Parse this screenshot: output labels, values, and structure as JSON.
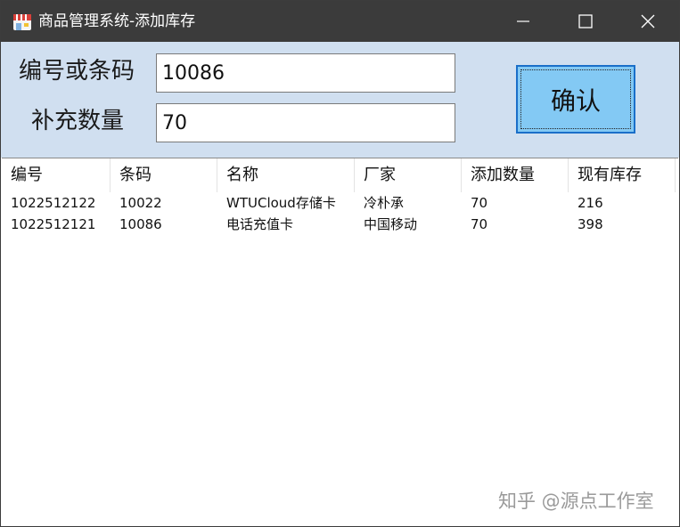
{
  "window": {
    "title": "商品管理系统-添加库存",
    "icon": "store-icon",
    "controls": [
      "minimize-icon",
      "maximize-icon",
      "close-icon"
    ],
    "titlebar_color": "#3b3b3b"
  },
  "form": {
    "code_label": "编号或条码",
    "code_value": "10086",
    "qty_label": "补充数量",
    "qty_value": "70",
    "confirm_label": "确认",
    "panel_color": "#d0dff0",
    "button_color": "#83c9f4"
  },
  "table": {
    "columns": [
      "编号",
      "条码",
      "名称",
      "厂家",
      "添加数量",
      "现有库存"
    ],
    "rows": [
      [
        "1022512122",
        "10022",
        "WTUCloud存储卡",
        "冷朴承",
        "70",
        "216"
      ],
      [
        "1022512121",
        "10086",
        "电话充值卡",
        "中国移动",
        "70",
        "398"
      ]
    ]
  },
  "watermark": "知乎 @源点工作室"
}
